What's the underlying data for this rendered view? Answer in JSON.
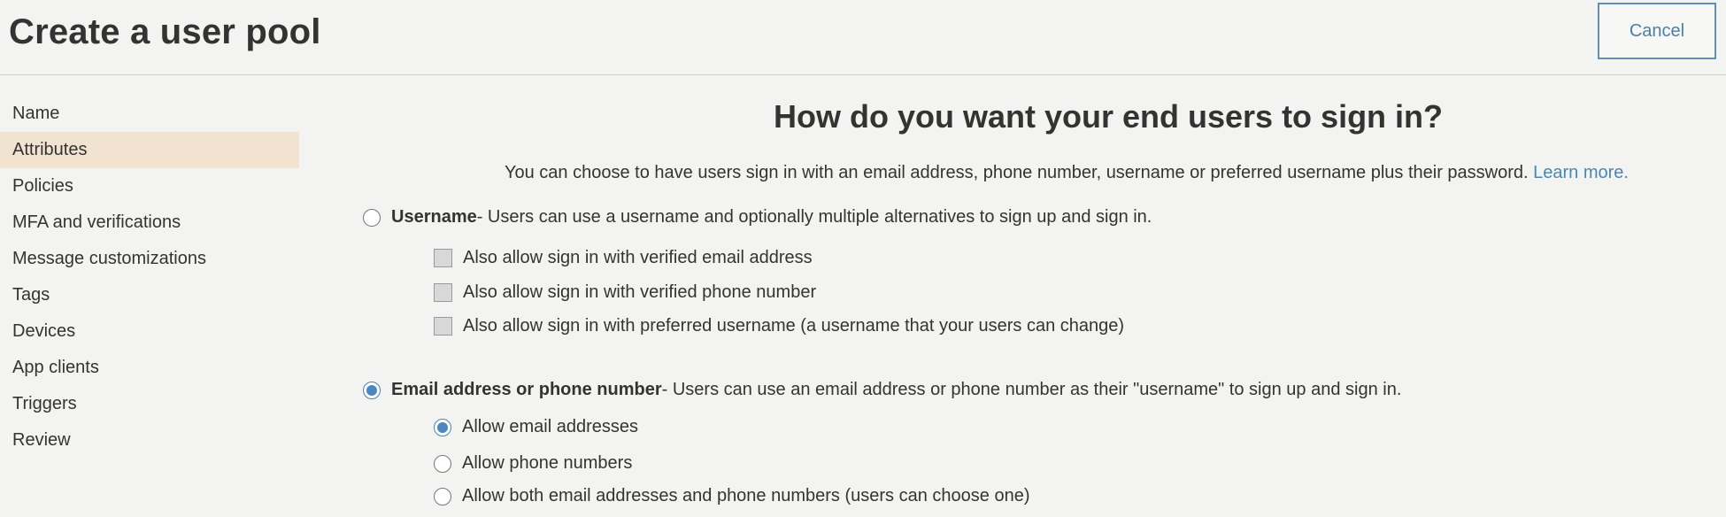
{
  "header": {
    "title": "Create a user pool",
    "cancel_label": "Cancel"
  },
  "sidebar": {
    "items": [
      {
        "label": "Name",
        "active": false
      },
      {
        "label": "Attributes",
        "active": true
      },
      {
        "label": "Policies",
        "active": false
      },
      {
        "label": "MFA and verifications",
        "active": false
      },
      {
        "label": "Message customizations",
        "active": false
      },
      {
        "label": "Tags",
        "active": false
      },
      {
        "label": "Devices",
        "active": false
      },
      {
        "label": "App clients",
        "active": false
      },
      {
        "label": "Triggers",
        "active": false
      },
      {
        "label": "Review",
        "active": false
      }
    ]
  },
  "main": {
    "heading": "How do you want your end users to sign in?",
    "subtitle": "You can choose to have users sign in with an email address, phone number, username or preferred username plus their password.",
    "learn_more": "Learn more.",
    "username_option": {
      "title": "Username",
      "description": " - Users can use a username and optionally multiple alternatives to sign up and sign in.",
      "selected": false,
      "checkboxes": [
        {
          "label": "Also allow sign in with verified email address",
          "checked": false
        },
        {
          "label": "Also allow sign in with verified phone number",
          "checked": false
        },
        {
          "label": "Also allow sign in with preferred username (a username that your users can change)",
          "checked": false
        }
      ]
    },
    "email_phone_option": {
      "title": "Email address or phone number",
      "description": " - Users can use an email address or phone number as their \"username\" to sign up and sign in.",
      "selected": true,
      "radios": [
        {
          "label": "Allow email addresses",
          "selected": true
        },
        {
          "label": "Allow phone numbers",
          "selected": false
        },
        {
          "label": "Allow both email addresses and phone numbers (users can choose one)",
          "selected": false
        }
      ]
    }
  },
  "colors": {
    "accent": "#4a86b5",
    "active_nav": "#f2e3d1",
    "background": "#f3f4f2"
  }
}
